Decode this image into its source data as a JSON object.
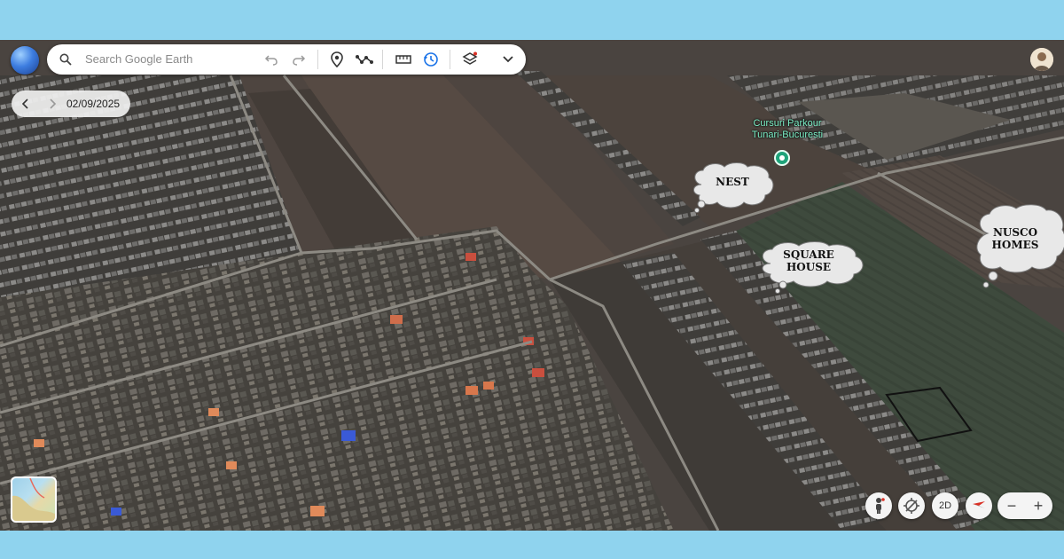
{
  "app": {
    "name": "Google Earth"
  },
  "search": {
    "placeholder": "Search Google Earth"
  },
  "toolbar": {
    "icons": [
      "undo-icon",
      "redo-icon",
      "placemark-icon",
      "path-icon",
      "ruler-icon",
      "history-icon",
      "layers-icon",
      "chevron-down-icon"
    ]
  },
  "timeline": {
    "date": "02/09/2025"
  },
  "map": {
    "place_label": "Cursuri Parkour Tunari-Bucuresti",
    "callouts": [
      {
        "text": "NEST"
      },
      {
        "text": "SQUARE HOUSE"
      },
      {
        "text": "NUSCO HOMES"
      }
    ]
  },
  "controls": {
    "view_mode": "2D",
    "zoom_in": "+",
    "zoom_out": "−"
  },
  "colors": {
    "frame": "#8fd3ee",
    "pin": "#1fa37a",
    "label": "#7ef2c9"
  }
}
